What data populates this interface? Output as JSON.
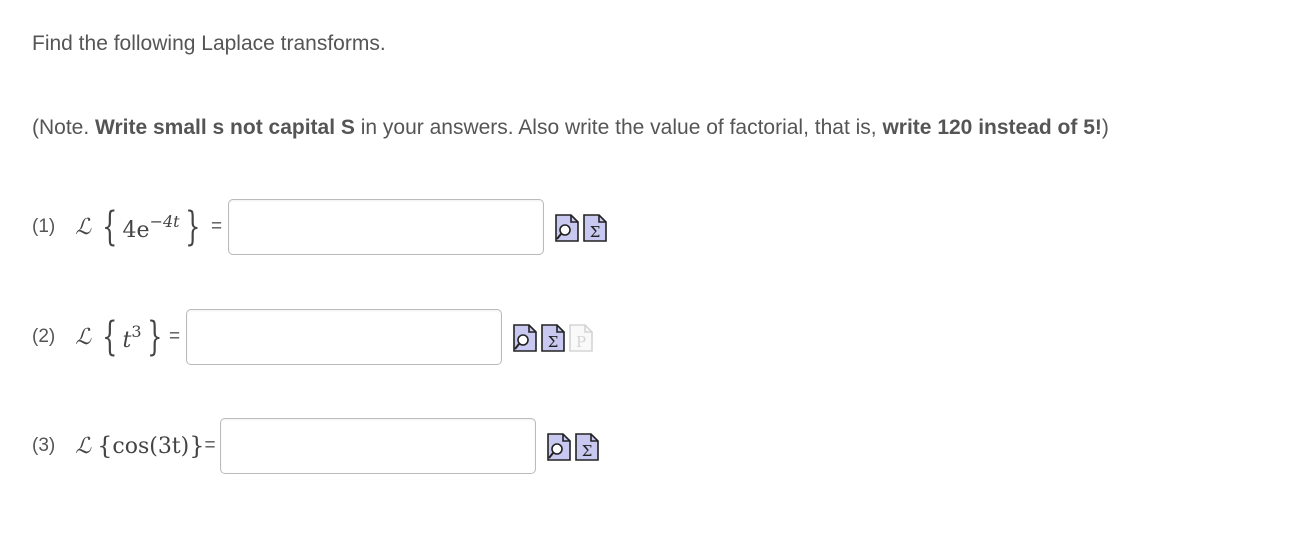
{
  "instructions": {
    "intro": "Find the following Laplace transforms.",
    "note_parts": [
      {
        "text": "(Note. ",
        "bold": false
      },
      {
        "text": "Write small s not capital S",
        "bold": true
      },
      {
        "text": " in your answers. Also write the value of factorial, that is, ",
        "bold": false
      },
      {
        "text": "write 120 instead of 5!",
        "bold": true
      },
      {
        "text": ")",
        "bold": false
      }
    ]
  },
  "questions": [
    {
      "number": "(1)",
      "operator": "ℒ",
      "open_brace": "{",
      "base": "4e",
      "exponent": "−4t",
      "close_brace": "}",
      "equals": "=",
      "value": "",
      "tools": [
        "preview-icon",
        "equation-editor-icon"
      ]
    },
    {
      "number": "(2)",
      "operator": "ℒ",
      "open_brace": "{",
      "base": "t",
      "exponent": "3",
      "close_brace": "}",
      "equals": "=",
      "value": "",
      "tools": [
        "preview-icon",
        "equation-editor-icon",
        "formula-palette-icon"
      ]
    },
    {
      "number": "(3)",
      "operator": "ℒ",
      "open_brace": "{",
      "base": "cos(3t)",
      "exponent": "",
      "close_brace": "}",
      "equals": "=",
      "value": "",
      "tools": [
        "preview-icon",
        "equation-editor-icon"
      ]
    }
  ],
  "tool_icons": {
    "preview_glyph": "🔍",
    "equation_glyph": "Σ",
    "palette_glyph": "P",
    "icon_fill": "#c8c8f0",
    "icon_stroke": "#222222",
    "disabled_stroke": "#b0b0b0"
  }
}
